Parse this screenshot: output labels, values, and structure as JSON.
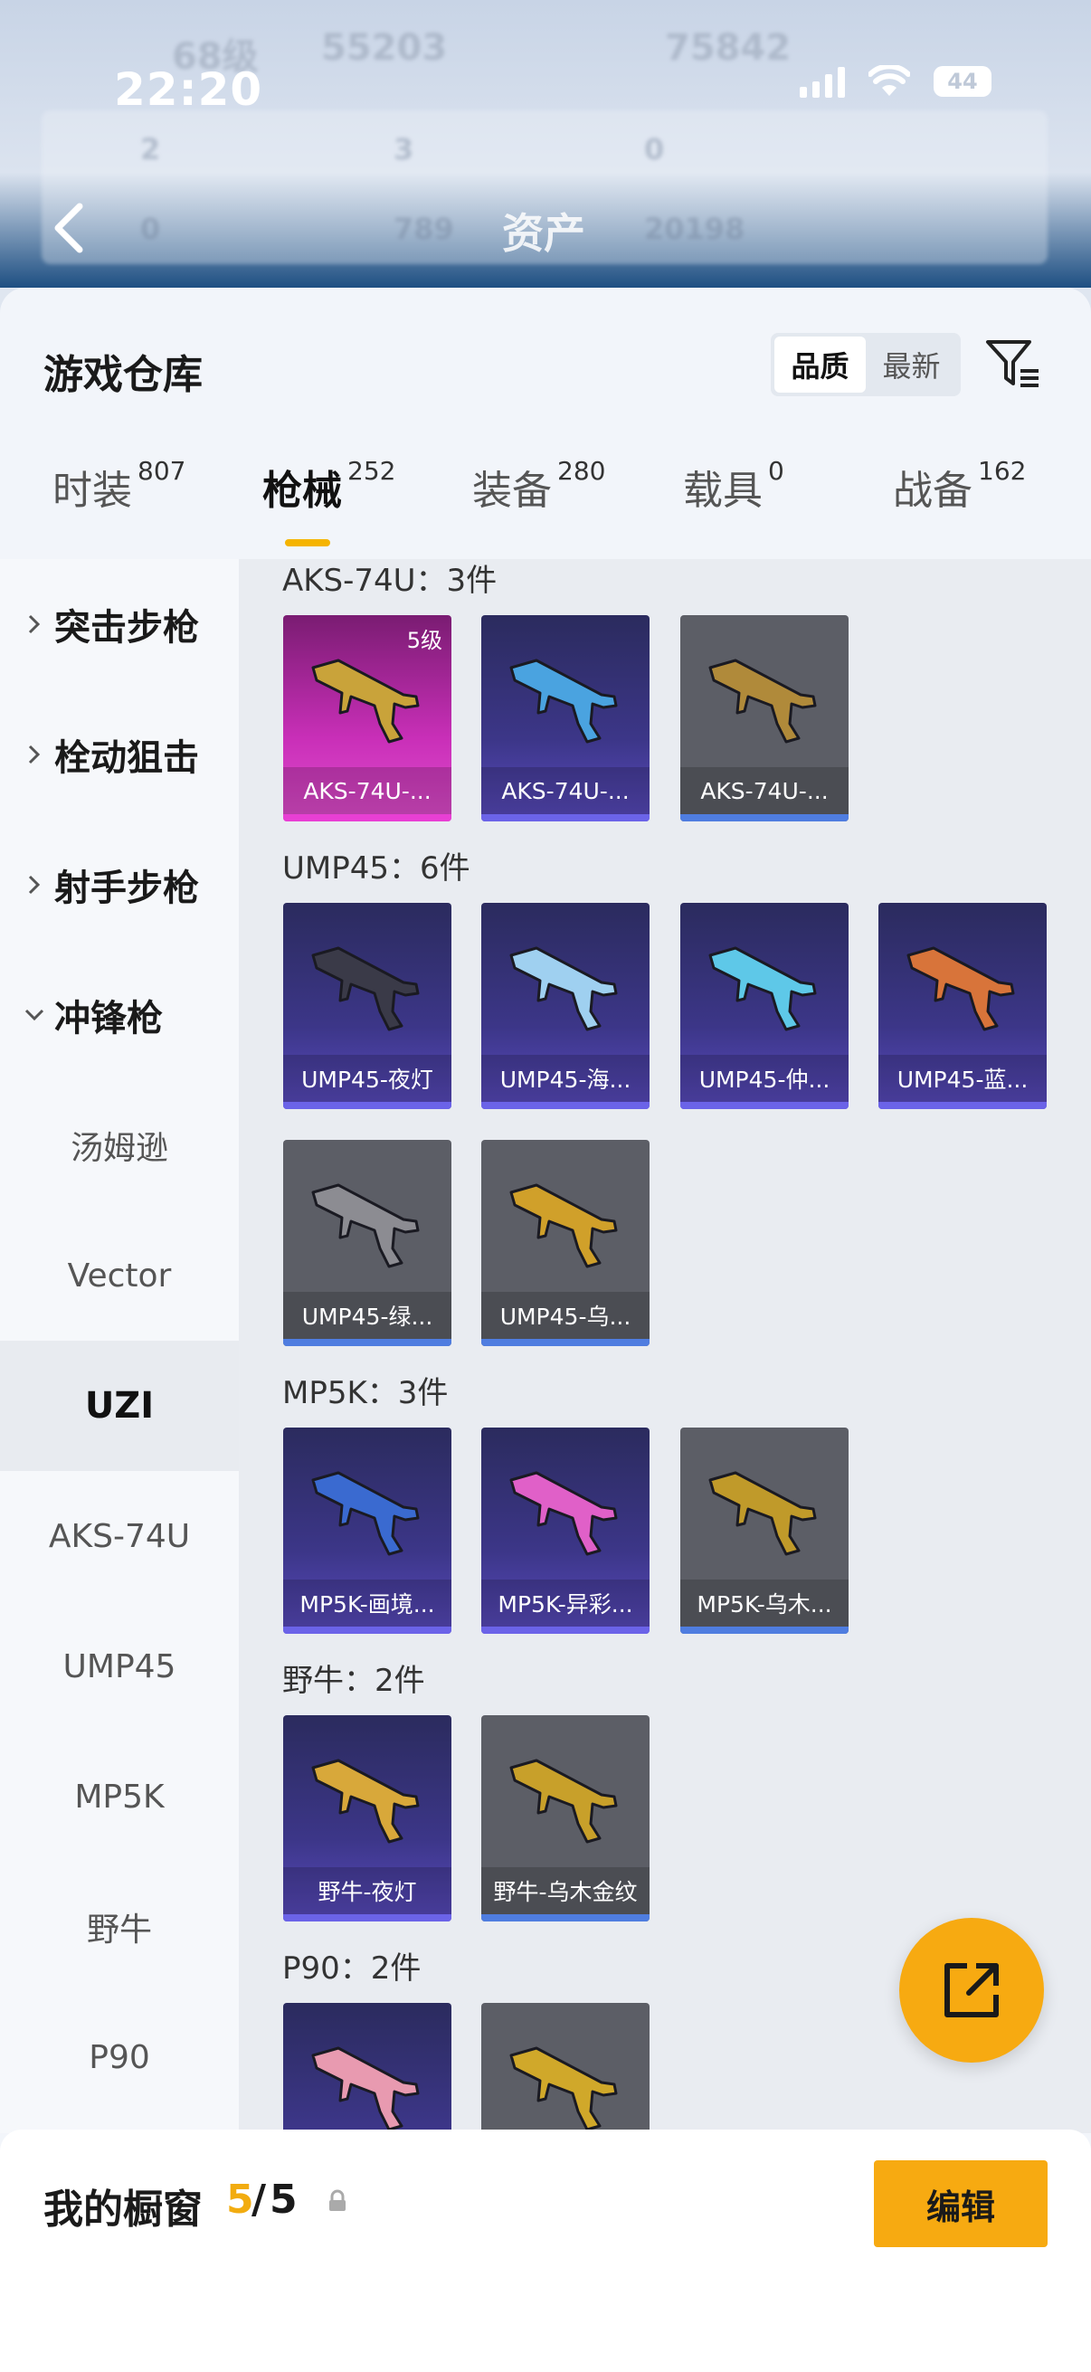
{
  "status_bar": {
    "time": "22:20",
    "battery": "44"
  },
  "background_header": {
    "title": "资产",
    "blur_texts": [
      "68级",
      "55203",
      "75842",
      "2",
      "3",
      "0",
      "0",
      "789",
      "20198"
    ]
  },
  "sheet": {
    "title": "游戏仓库",
    "sort": {
      "options": [
        "品质",
        "最新"
      ],
      "selected": "品质"
    }
  },
  "tabs": [
    {
      "label": "时装",
      "count": "807"
    },
    {
      "label": "枪械",
      "count": "252",
      "active": true
    },
    {
      "label": "装备",
      "count": "280"
    },
    {
      "label": "载具",
      "count": "0"
    },
    {
      "label": "战备",
      "count": "162"
    }
  ],
  "sidebar": {
    "categories": [
      "突击步枪",
      "栓动狙击",
      "射手步枪",
      "冲锋枪"
    ],
    "subitems": [
      "汤姆逊",
      "Vector",
      "UZI",
      "AKS-74U",
      "UMP45",
      "MP5K",
      "野牛",
      "P90"
    ],
    "selected": "UZI"
  },
  "groups": [
    {
      "title": "AKS-74U：3件",
      "items": [
        {
          "name": "AKS-74U-...",
          "level": "5级",
          "rarity": "pink",
          "color": "#c9a33a"
        },
        {
          "name": "AKS-74U-...",
          "rarity": "purple",
          "color": "#4aa3e0"
        },
        {
          "name": "AKS-74U-...",
          "rarity": "gray",
          "color": "#b08a3a"
        }
      ]
    },
    {
      "title": "UMP45：6件",
      "items": [
        {
          "name": "UMP45-夜灯",
          "rarity": "purple",
          "color": "#3a3a48"
        },
        {
          "name": "UMP45-海...",
          "rarity": "purple",
          "color": "#9fd0f0"
        },
        {
          "name": "UMP45-仲...",
          "rarity": "purple",
          "color": "#5ec8e8"
        },
        {
          "name": "UMP45-蓝...",
          "rarity": "purple",
          "color": "#d8743a"
        },
        {
          "name": "UMP45-绿...",
          "rarity": "gray",
          "color": "#8c8c92"
        },
        {
          "name": "UMP45-乌...",
          "rarity": "gray",
          "color": "#d0a02a"
        }
      ]
    },
    {
      "title": "MP5K：3件",
      "items": [
        {
          "name": "MP5K-画境...",
          "rarity": "purple",
          "color": "#3a6ad0"
        },
        {
          "name": "MP5K-异彩...",
          "rarity": "purple",
          "color": "#e060c8"
        },
        {
          "name": "MP5K-乌木...",
          "rarity": "gray",
          "color": "#c09a2a"
        }
      ]
    },
    {
      "title": "野牛：2件",
      "items": [
        {
          "name": "野牛-夜灯",
          "rarity": "purple",
          "color": "#d8a83a"
        },
        {
          "name": "野牛-乌木金纹",
          "rarity": "gray",
          "color": "#c8a02a"
        }
      ]
    },
    {
      "title": "P90：2件",
      "items": [
        {
          "name": "",
          "rarity": "purple",
          "color": "#e89ab0"
        },
        {
          "name": "",
          "rarity": "gray",
          "color": "#d0a82a"
        }
      ]
    }
  ],
  "bottom": {
    "label": "我的橱窗",
    "current": "5",
    "separator": "/",
    "max": "5",
    "edit": "编辑"
  }
}
